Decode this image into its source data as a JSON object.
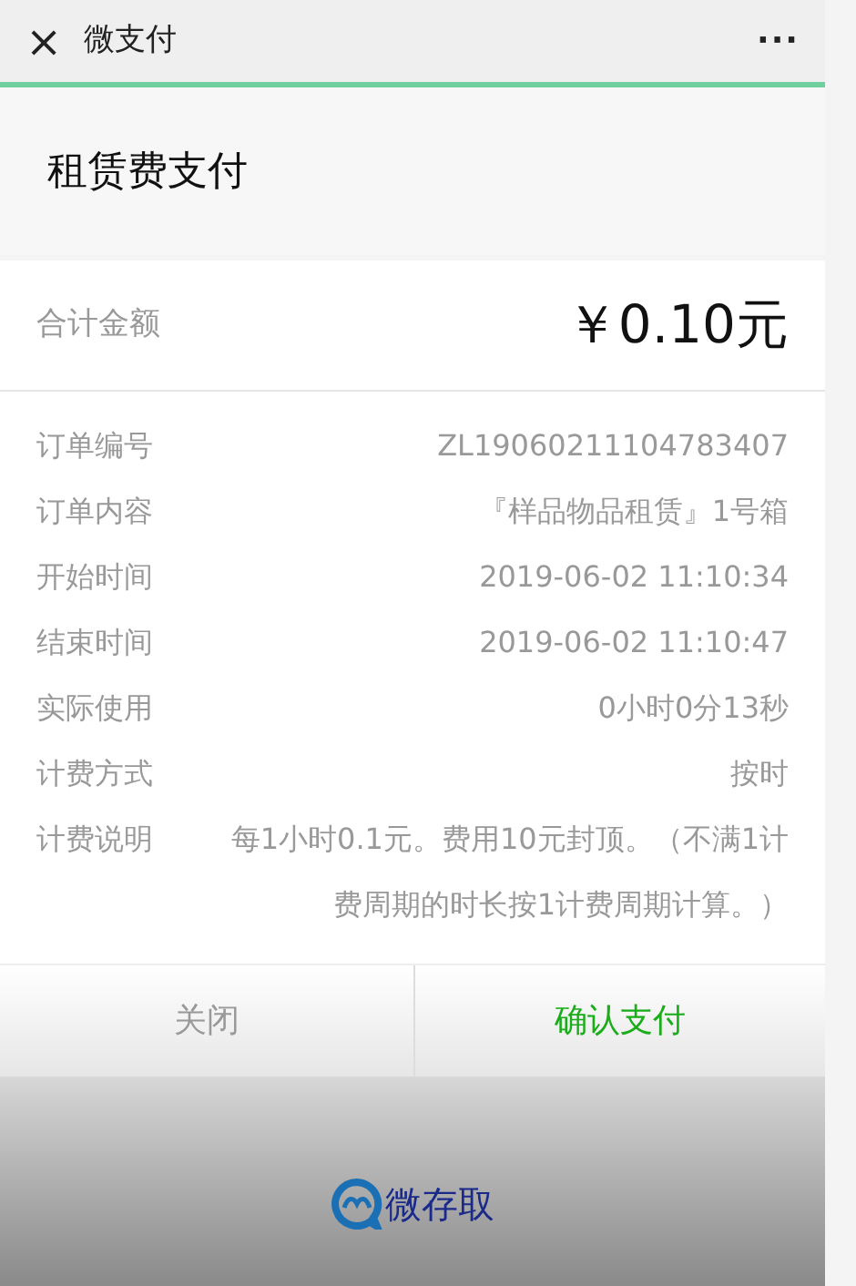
{
  "top_bar": {
    "close": "×",
    "title": "微支付",
    "more": "···"
  },
  "page_title": "租赁费支付",
  "total": {
    "label": "合计金额",
    "amount": "￥0.10元"
  },
  "details": [
    {
      "label": "订单编号",
      "value": "ZL19060211104783407"
    },
    {
      "label": "订单内容",
      "value": "『样品物品租赁』1号箱"
    },
    {
      "label": "开始时间",
      "value": "2019-06-02 11:10:34"
    },
    {
      "label": "结束时间",
      "value": "2019-06-02 11:10:47"
    },
    {
      "label": "实际使用",
      "value": "0小时0分13秒"
    },
    {
      "label": "计费方式",
      "value": "按时"
    },
    {
      "label": "计费说明",
      "value": "每1小时0.1元。费用10元封顶。（不满1计费周期的时长按1计费周期计算。）"
    }
  ],
  "buttons": [
    {
      "label": "关闭",
      "kind": "cancel"
    },
    {
      "label": "确认支付",
      "kind": "confirm"
    }
  ],
  "footer": {
    "brand": "微存取"
  }
}
